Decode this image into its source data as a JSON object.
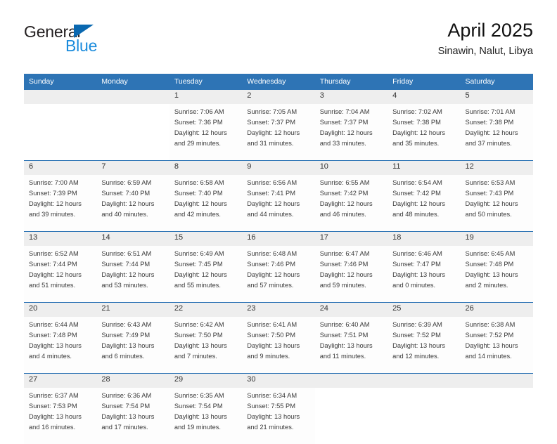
{
  "brand": {
    "name_part1": "General",
    "name_part2": "Blue",
    "accent_color": "#1a8bdc",
    "triangle_color": "#0a68b0"
  },
  "header": {
    "title": "April 2025",
    "subtitle": "Sinawin, Nalut, Libya"
  },
  "calendar": {
    "header_color": "#2e74b5",
    "weekday_headers": [
      "Sunday",
      "Monday",
      "Tuesday",
      "Wednesday",
      "Thursday",
      "Friday",
      "Saturday"
    ],
    "weeks": [
      {
        "days": [
          {
            "number": "",
            "sunrise": "",
            "sunset": "",
            "daylight_line1": "",
            "daylight_line2": "",
            "empty": true
          },
          {
            "number": "",
            "sunrise": "",
            "sunset": "",
            "daylight_line1": "",
            "daylight_line2": "",
            "empty": true
          },
          {
            "number": "1",
            "sunrise": "Sunrise: 7:06 AM",
            "sunset": "Sunset: 7:36 PM",
            "daylight_line1": "Daylight: 12 hours",
            "daylight_line2": "and 29 minutes.",
            "empty": false
          },
          {
            "number": "2",
            "sunrise": "Sunrise: 7:05 AM",
            "sunset": "Sunset: 7:37 PM",
            "daylight_line1": "Daylight: 12 hours",
            "daylight_line2": "and 31 minutes.",
            "empty": false
          },
          {
            "number": "3",
            "sunrise": "Sunrise: 7:04 AM",
            "sunset": "Sunset: 7:37 PM",
            "daylight_line1": "Daylight: 12 hours",
            "daylight_line2": "and 33 minutes.",
            "empty": false
          },
          {
            "number": "4",
            "sunrise": "Sunrise: 7:02 AM",
            "sunset": "Sunset: 7:38 PM",
            "daylight_line1": "Daylight: 12 hours",
            "daylight_line2": "and 35 minutes.",
            "empty": false
          },
          {
            "number": "5",
            "sunrise": "Sunrise: 7:01 AM",
            "sunset": "Sunset: 7:38 PM",
            "daylight_line1": "Daylight: 12 hours",
            "daylight_line2": "and 37 minutes.",
            "empty": false
          }
        ]
      },
      {
        "days": [
          {
            "number": "6",
            "sunrise": "Sunrise: 7:00 AM",
            "sunset": "Sunset: 7:39 PM",
            "daylight_line1": "Daylight: 12 hours",
            "daylight_line2": "and 39 minutes.",
            "empty": false
          },
          {
            "number": "7",
            "sunrise": "Sunrise: 6:59 AM",
            "sunset": "Sunset: 7:40 PM",
            "daylight_line1": "Daylight: 12 hours",
            "daylight_line2": "and 40 minutes.",
            "empty": false
          },
          {
            "number": "8",
            "sunrise": "Sunrise: 6:58 AM",
            "sunset": "Sunset: 7:40 PM",
            "daylight_line1": "Daylight: 12 hours",
            "daylight_line2": "and 42 minutes.",
            "empty": false
          },
          {
            "number": "9",
            "sunrise": "Sunrise: 6:56 AM",
            "sunset": "Sunset: 7:41 PM",
            "daylight_line1": "Daylight: 12 hours",
            "daylight_line2": "and 44 minutes.",
            "empty": false
          },
          {
            "number": "10",
            "sunrise": "Sunrise: 6:55 AM",
            "sunset": "Sunset: 7:42 PM",
            "daylight_line1": "Daylight: 12 hours",
            "daylight_line2": "and 46 minutes.",
            "empty": false
          },
          {
            "number": "11",
            "sunrise": "Sunrise: 6:54 AM",
            "sunset": "Sunset: 7:42 PM",
            "daylight_line1": "Daylight: 12 hours",
            "daylight_line2": "and 48 minutes.",
            "empty": false
          },
          {
            "number": "12",
            "sunrise": "Sunrise: 6:53 AM",
            "sunset": "Sunset: 7:43 PM",
            "daylight_line1": "Daylight: 12 hours",
            "daylight_line2": "and 50 minutes.",
            "empty": false
          }
        ]
      },
      {
        "days": [
          {
            "number": "13",
            "sunrise": "Sunrise: 6:52 AM",
            "sunset": "Sunset: 7:44 PM",
            "daylight_line1": "Daylight: 12 hours",
            "daylight_line2": "and 51 minutes.",
            "empty": false
          },
          {
            "number": "14",
            "sunrise": "Sunrise: 6:51 AM",
            "sunset": "Sunset: 7:44 PM",
            "daylight_line1": "Daylight: 12 hours",
            "daylight_line2": "and 53 minutes.",
            "empty": false
          },
          {
            "number": "15",
            "sunrise": "Sunrise: 6:49 AM",
            "sunset": "Sunset: 7:45 PM",
            "daylight_line1": "Daylight: 12 hours",
            "daylight_line2": "and 55 minutes.",
            "empty": false
          },
          {
            "number": "16",
            "sunrise": "Sunrise: 6:48 AM",
            "sunset": "Sunset: 7:46 PM",
            "daylight_line1": "Daylight: 12 hours",
            "daylight_line2": "and 57 minutes.",
            "empty": false
          },
          {
            "number": "17",
            "sunrise": "Sunrise: 6:47 AM",
            "sunset": "Sunset: 7:46 PM",
            "daylight_line1": "Daylight: 12 hours",
            "daylight_line2": "and 59 minutes.",
            "empty": false
          },
          {
            "number": "18",
            "sunrise": "Sunrise: 6:46 AM",
            "sunset": "Sunset: 7:47 PM",
            "daylight_line1": "Daylight: 13 hours",
            "daylight_line2": "and 0 minutes.",
            "empty": false
          },
          {
            "number": "19",
            "sunrise": "Sunrise: 6:45 AM",
            "sunset": "Sunset: 7:48 PM",
            "daylight_line1": "Daylight: 13 hours",
            "daylight_line2": "and 2 minutes.",
            "empty": false
          }
        ]
      },
      {
        "days": [
          {
            "number": "20",
            "sunrise": "Sunrise: 6:44 AM",
            "sunset": "Sunset: 7:48 PM",
            "daylight_line1": "Daylight: 13 hours",
            "daylight_line2": "and 4 minutes.",
            "empty": false
          },
          {
            "number": "21",
            "sunrise": "Sunrise: 6:43 AM",
            "sunset": "Sunset: 7:49 PM",
            "daylight_line1": "Daylight: 13 hours",
            "daylight_line2": "and 6 minutes.",
            "empty": false
          },
          {
            "number": "22",
            "sunrise": "Sunrise: 6:42 AM",
            "sunset": "Sunset: 7:50 PM",
            "daylight_line1": "Daylight: 13 hours",
            "daylight_line2": "and 7 minutes.",
            "empty": false
          },
          {
            "number": "23",
            "sunrise": "Sunrise: 6:41 AM",
            "sunset": "Sunset: 7:50 PM",
            "daylight_line1": "Daylight: 13 hours",
            "daylight_line2": "and 9 minutes.",
            "empty": false
          },
          {
            "number": "24",
            "sunrise": "Sunrise: 6:40 AM",
            "sunset": "Sunset: 7:51 PM",
            "daylight_line1": "Daylight: 13 hours",
            "daylight_line2": "and 11 minutes.",
            "empty": false
          },
          {
            "number": "25",
            "sunrise": "Sunrise: 6:39 AM",
            "sunset": "Sunset: 7:52 PM",
            "daylight_line1": "Daylight: 13 hours",
            "daylight_line2": "and 12 minutes.",
            "empty": false
          },
          {
            "number": "26",
            "sunrise": "Sunrise: 6:38 AM",
            "sunset": "Sunset: 7:52 PM",
            "daylight_line1": "Daylight: 13 hours",
            "daylight_line2": "and 14 minutes.",
            "empty": false
          }
        ]
      },
      {
        "days": [
          {
            "number": "27",
            "sunrise": "Sunrise: 6:37 AM",
            "sunset": "Sunset: 7:53 PM",
            "daylight_line1": "Daylight: 13 hours",
            "daylight_line2": "and 16 minutes.",
            "empty": false
          },
          {
            "number": "28",
            "sunrise": "Sunrise: 6:36 AM",
            "sunset": "Sunset: 7:54 PM",
            "daylight_line1": "Daylight: 13 hours",
            "daylight_line2": "and 17 minutes.",
            "empty": false
          },
          {
            "number": "29",
            "sunrise": "Sunrise: 6:35 AM",
            "sunset": "Sunset: 7:54 PM",
            "daylight_line1": "Daylight: 13 hours",
            "daylight_line2": "and 19 minutes.",
            "empty": false
          },
          {
            "number": "30",
            "sunrise": "Sunrise: 6:34 AM",
            "sunset": "Sunset: 7:55 PM",
            "daylight_line1": "Daylight: 13 hours",
            "daylight_line2": "and 21 minutes.",
            "empty": false
          },
          {
            "number": "",
            "sunrise": "",
            "sunset": "",
            "daylight_line1": "",
            "daylight_line2": "",
            "empty": true
          },
          {
            "number": "",
            "sunrise": "",
            "sunset": "",
            "daylight_line1": "",
            "daylight_line2": "",
            "empty": true
          },
          {
            "number": "",
            "sunrise": "",
            "sunset": "",
            "daylight_line1": "",
            "daylight_line2": "",
            "empty": true
          }
        ]
      }
    ]
  }
}
